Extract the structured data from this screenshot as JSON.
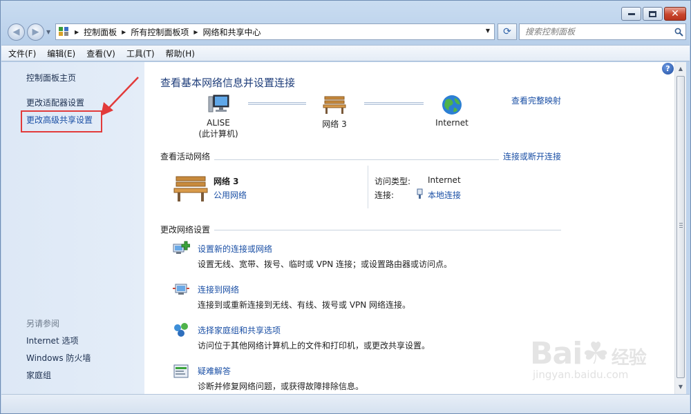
{
  "address": {
    "crumbs": [
      "控制面板",
      "所有控制面板项",
      "网络和共享中心"
    ],
    "search_placeholder": "搜索控制面板"
  },
  "menu": [
    "文件(F)",
    "编辑(E)",
    "查看(V)",
    "工具(T)",
    "帮助(H)"
  ],
  "sidebar": {
    "home": "控制面板主页",
    "adapter": "更改适配器设置",
    "sharing": "更改高级共享设置",
    "see_also": "另请参阅",
    "links": [
      "Internet 选项",
      "Windows 防火墙",
      "家庭组"
    ]
  },
  "main": {
    "heading": "查看基本网络信息并设置连接",
    "view_full_map": "查看完整映射",
    "map": {
      "computer_name": "ALISE",
      "computer_sub": "(此计算机)",
      "network": "网络  3",
      "internet": "Internet"
    },
    "active": {
      "title": "查看活动网络",
      "connect_link": "连接或断开连接",
      "network_name": "网络  3",
      "network_type": "公用网络",
      "access_label": "访问类型:",
      "access_value": "Internet",
      "conn_label": "连接:",
      "conn_value": "本地连接"
    },
    "change": {
      "title": "更改网络设置",
      "tasks": [
        {
          "title": "设置新的连接或网络",
          "desc": "设置无线、宽带、拨号、临时或 VPN 连接；或设置路由器或访问点。",
          "icon": "new-connection-icon"
        },
        {
          "title": "连接到网络",
          "desc": "连接到或重新连接到无线、有线、拨号或 VPN 网络连接。",
          "icon": "connect-network-icon"
        },
        {
          "title": "选择家庭组和共享选项",
          "desc": "访问位于其他网络计算机上的文件和打印机，或更改共享设置。",
          "icon": "homegroup-icon"
        },
        {
          "title": "疑难解答",
          "desc": "诊断并修复网络问题，或获得故障排除信息。",
          "icon": "troubleshoot-icon"
        }
      ]
    }
  },
  "watermark": {
    "main": "Bai",
    "main2": "经验",
    "sub": "jingyan.baidu.com"
  },
  "colors": {
    "link": "#1a4fa5",
    "highlight": "#e23a3a",
    "heading": "#1e3d7a"
  }
}
